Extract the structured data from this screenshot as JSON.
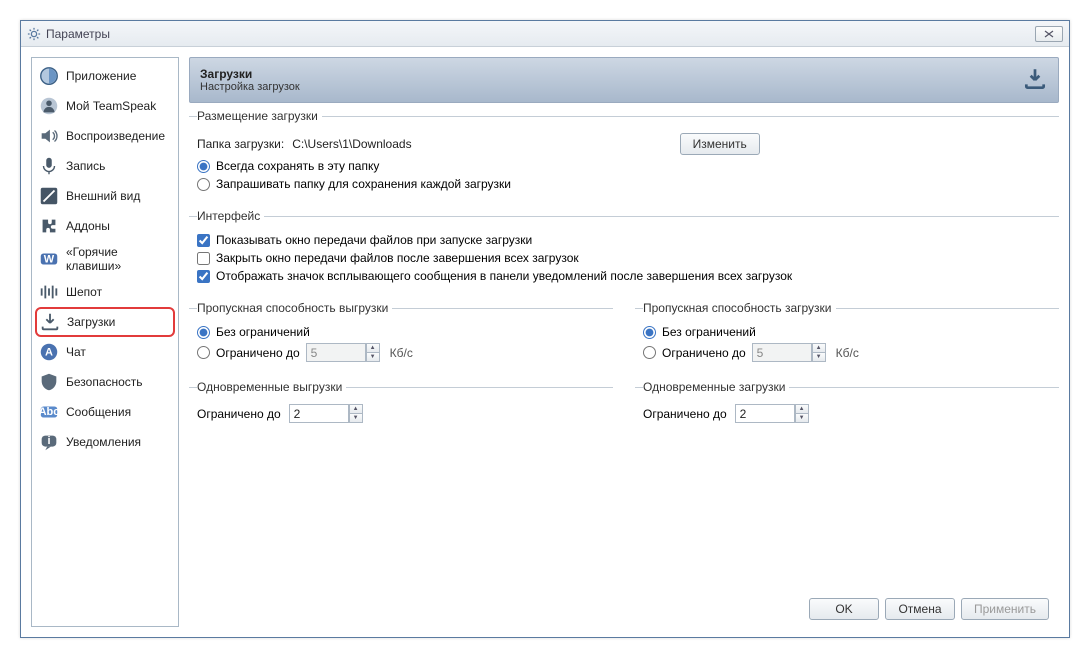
{
  "window": {
    "title": "Параметры"
  },
  "sidebar": {
    "items": [
      {
        "label": "Приложение"
      },
      {
        "label": "Мой TeamSpeak"
      },
      {
        "label": "Воспроизведение"
      },
      {
        "label": "Запись"
      },
      {
        "label": "Внешний вид"
      },
      {
        "label": "Аддоны"
      },
      {
        "label": "«Горячие клавиши»"
      },
      {
        "label": "Шепот"
      },
      {
        "label": "Загрузки"
      },
      {
        "label": "Чат"
      },
      {
        "label": "Безопасность"
      },
      {
        "label": "Сообщения"
      },
      {
        "label": "Уведомления"
      }
    ]
  },
  "header": {
    "title": "Загрузки",
    "subtitle": "Настройка загрузок"
  },
  "placement": {
    "legend": "Размещение загрузки",
    "folder_label": "Папка загрузки:",
    "folder_path": "C:\\Users\\1\\Downloads",
    "change_btn": "Изменить",
    "radio_always": "Всегда сохранять в эту папку",
    "radio_ask": "Запрашивать папку для сохранения каждой загрузки"
  },
  "interface": {
    "legend": "Интерфейс",
    "chk_show": "Показывать окно передачи файлов при запуске загрузки",
    "chk_close": "Закрыть окно передачи файлов после завершения всех загрузок",
    "chk_tray": "Отображать значок всплывающего сообщения в панели уведомлений после завершения всех загрузок"
  },
  "upload_bw": {
    "legend": "Пропускная способность выгрузки",
    "radio_none": "Без ограничений",
    "radio_limit": "Ограничено до",
    "value": "5",
    "unit": "Кб/с"
  },
  "download_bw": {
    "legend": "Пропускная способность загрузки",
    "radio_none": "Без ограничений",
    "radio_limit": "Ограничено до",
    "value": "5",
    "unit": "Кб/с"
  },
  "sim_upload": {
    "legend": "Одновременные выгрузки",
    "label": "Ограничено до",
    "value": "2"
  },
  "sim_download": {
    "legend": "Одновременные загрузки",
    "label": "Ограничено до",
    "value": "2"
  },
  "buttons": {
    "ok": "OK",
    "cancel": "Отмена",
    "apply": "Применить"
  }
}
